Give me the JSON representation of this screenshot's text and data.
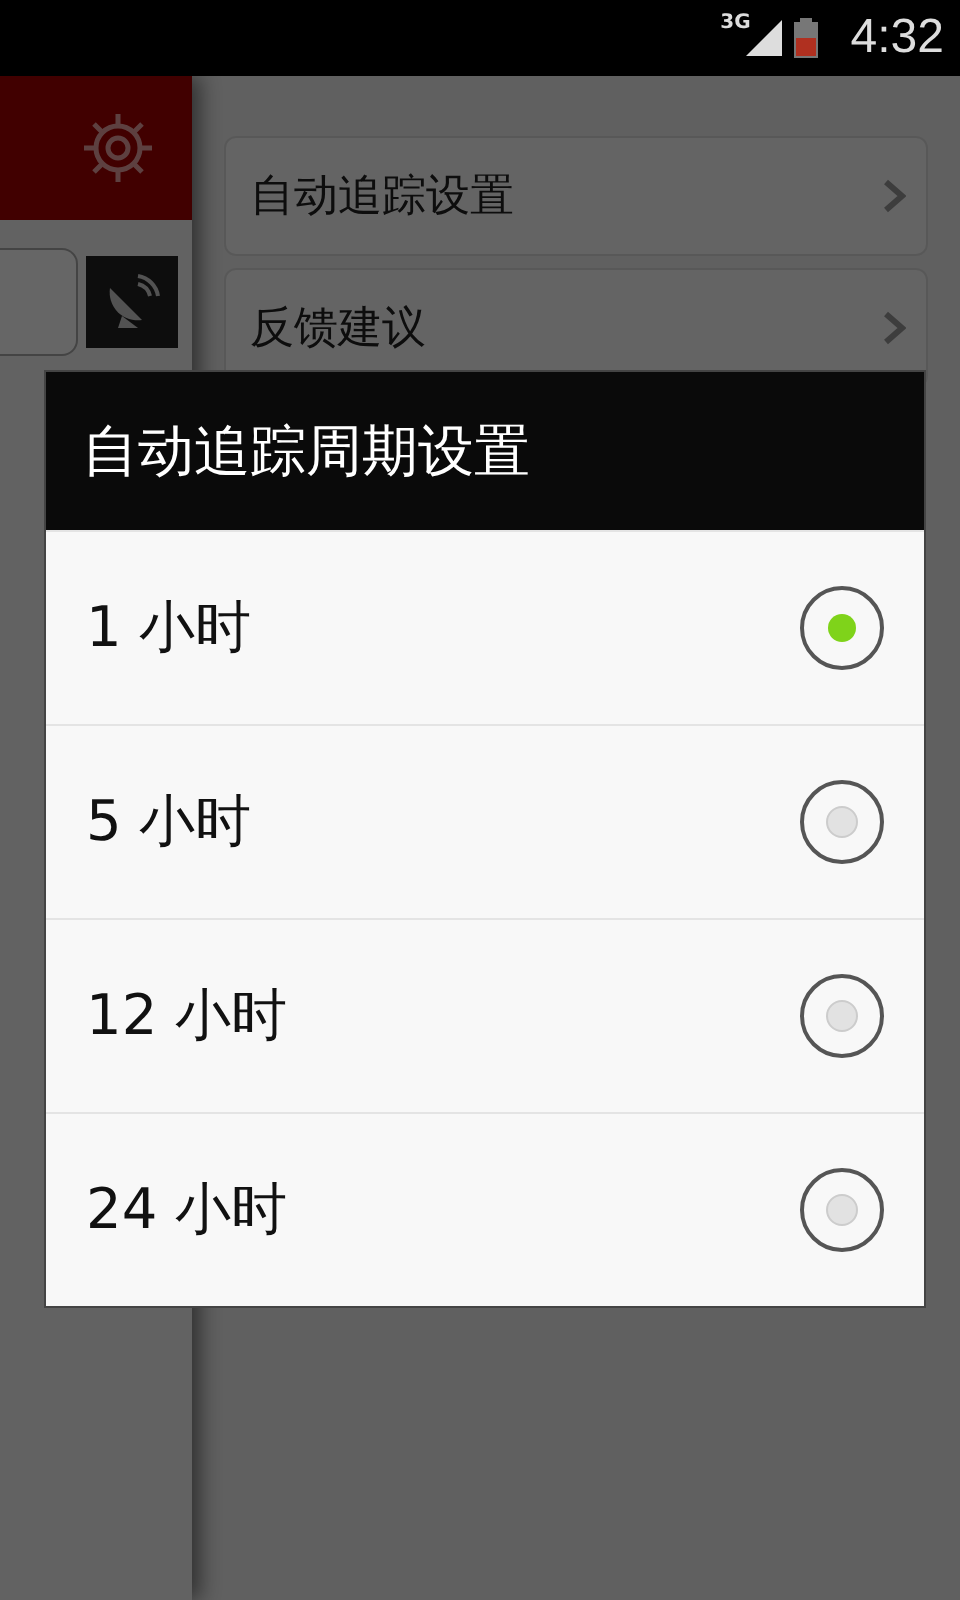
{
  "status_bar": {
    "network": "3G",
    "time": "4:32"
  },
  "background": {
    "menu_items": [
      {
        "label": "自动追踪设置"
      },
      {
        "label": "反馈建议"
      }
    ]
  },
  "dialog": {
    "title": "自动追踪周期设置",
    "options": [
      {
        "label": "1 小时",
        "selected": true
      },
      {
        "label": "5 小时",
        "selected": false
      },
      {
        "label": "12 小时",
        "selected": false
      },
      {
        "label": "24 小时",
        "selected": false
      }
    ]
  }
}
